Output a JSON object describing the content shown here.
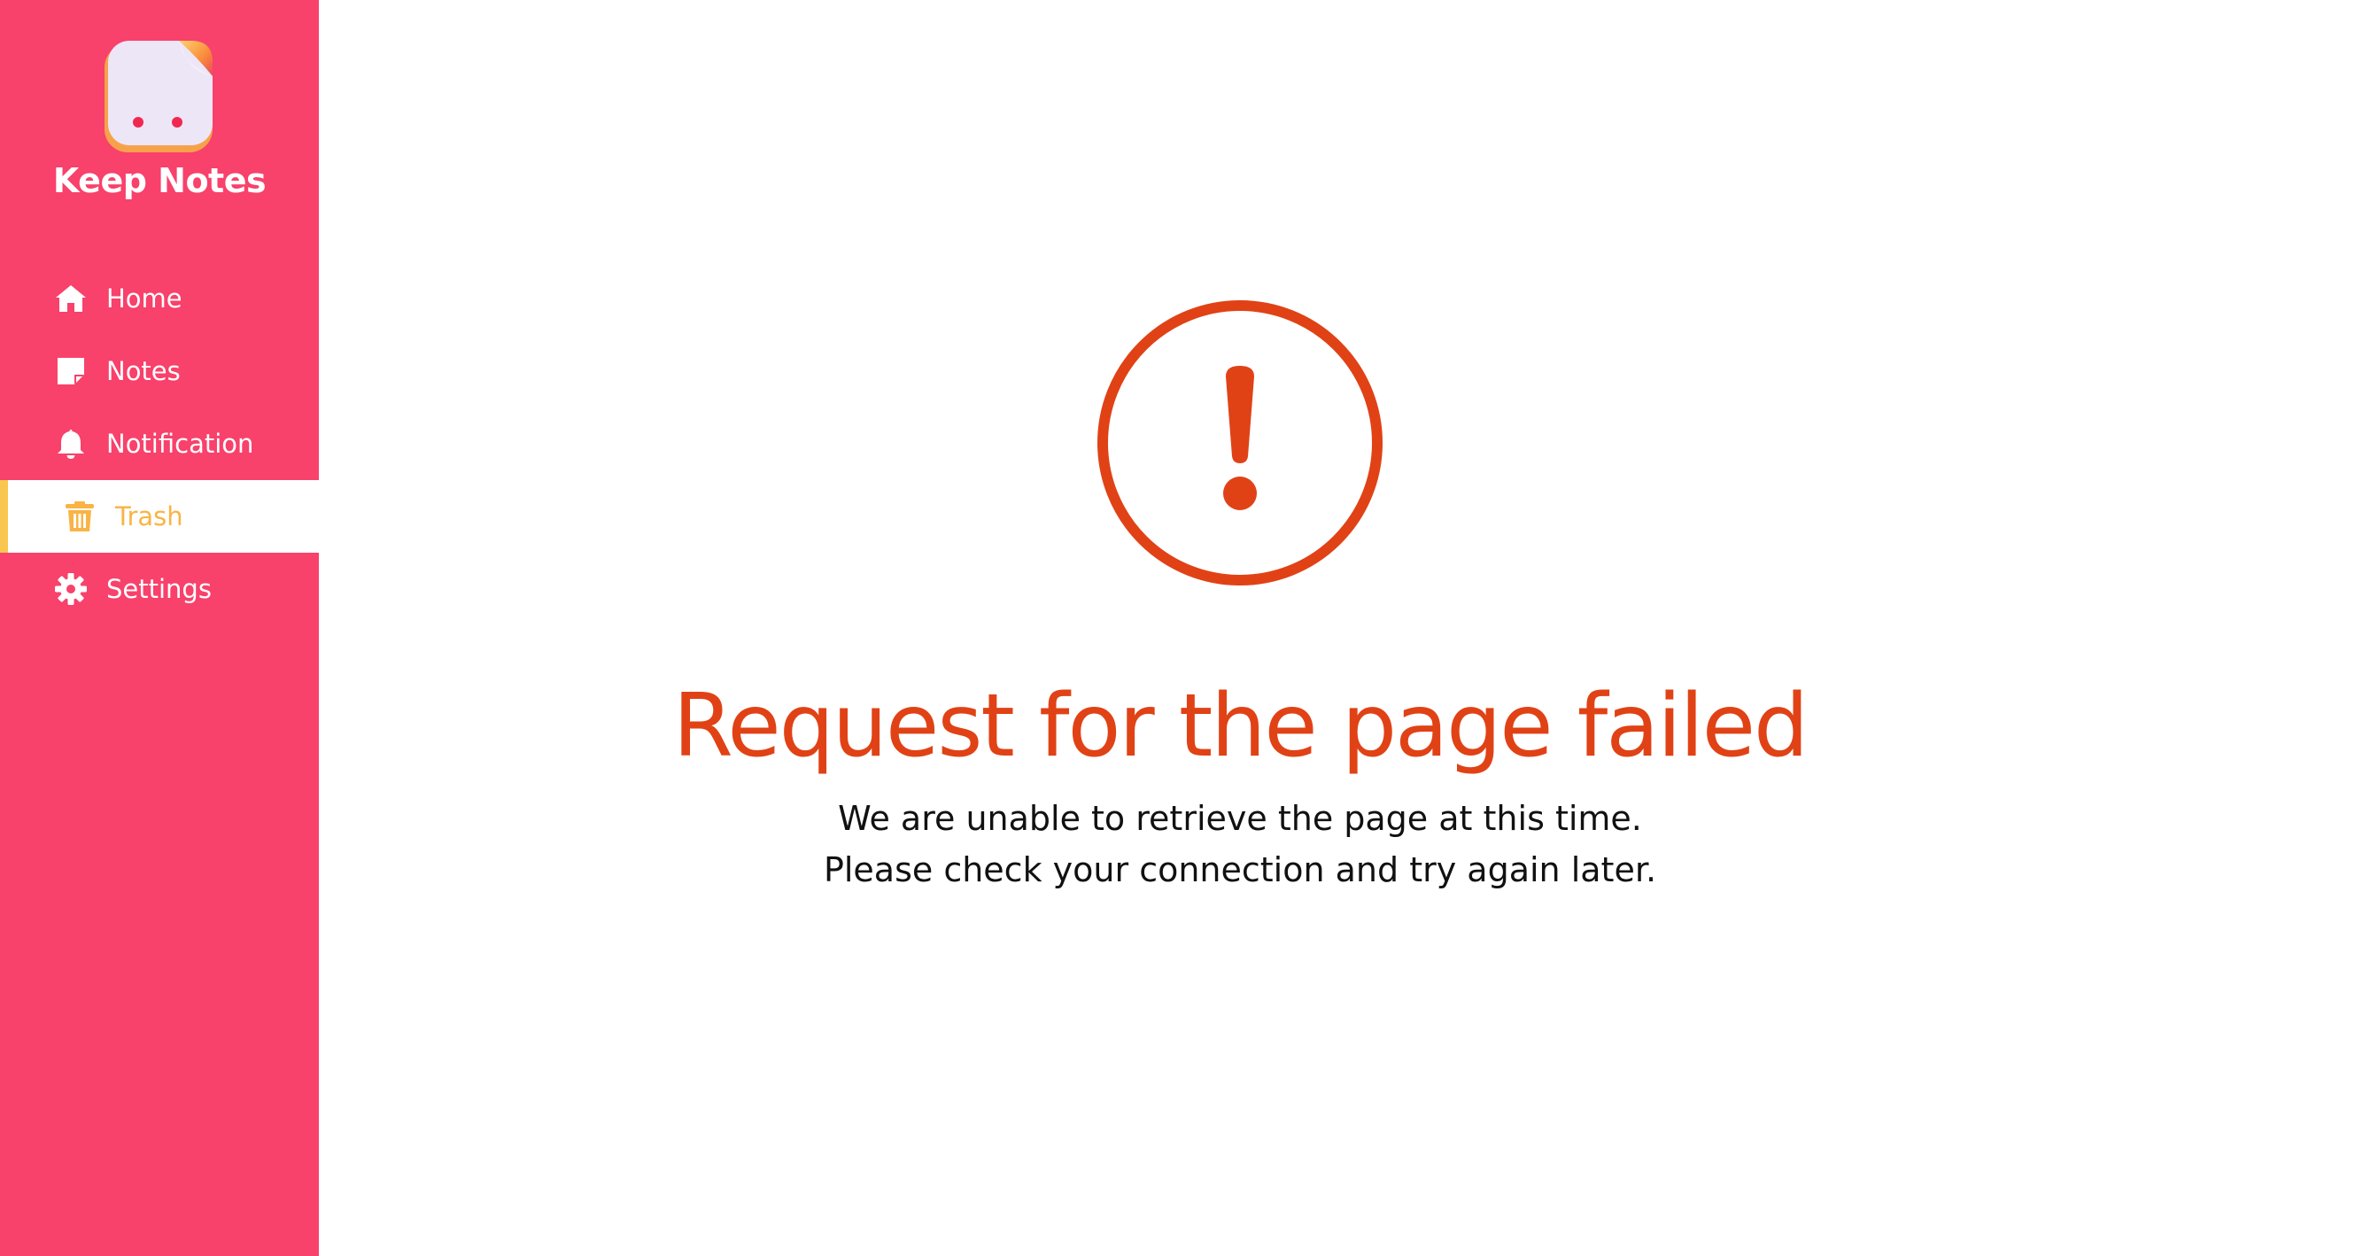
{
  "app": {
    "name": "Keep Notes"
  },
  "sidebar": {
    "items": [
      {
        "label": "Home",
        "icon": "home-icon",
        "active": false
      },
      {
        "label": "Notes",
        "icon": "note-icon",
        "active": false
      },
      {
        "label": "Notification",
        "icon": "bell-icon",
        "active": false
      },
      {
        "label": "Trash",
        "icon": "trash-icon",
        "active": true
      },
      {
        "label": "Settings",
        "icon": "gear-icon",
        "active": false
      }
    ]
  },
  "error": {
    "icon": "exclamation-circle-icon",
    "title": "Request for the page failed",
    "line1": "We are unable to retrieve the page at this time.",
    "line2": "Please check your connection and try again later."
  },
  "colors": {
    "sidebar_bg": "#f8416b",
    "active_text": "#f9b445",
    "active_indicator": "#f9c74f",
    "error": "#e04216",
    "text": "#111111"
  }
}
